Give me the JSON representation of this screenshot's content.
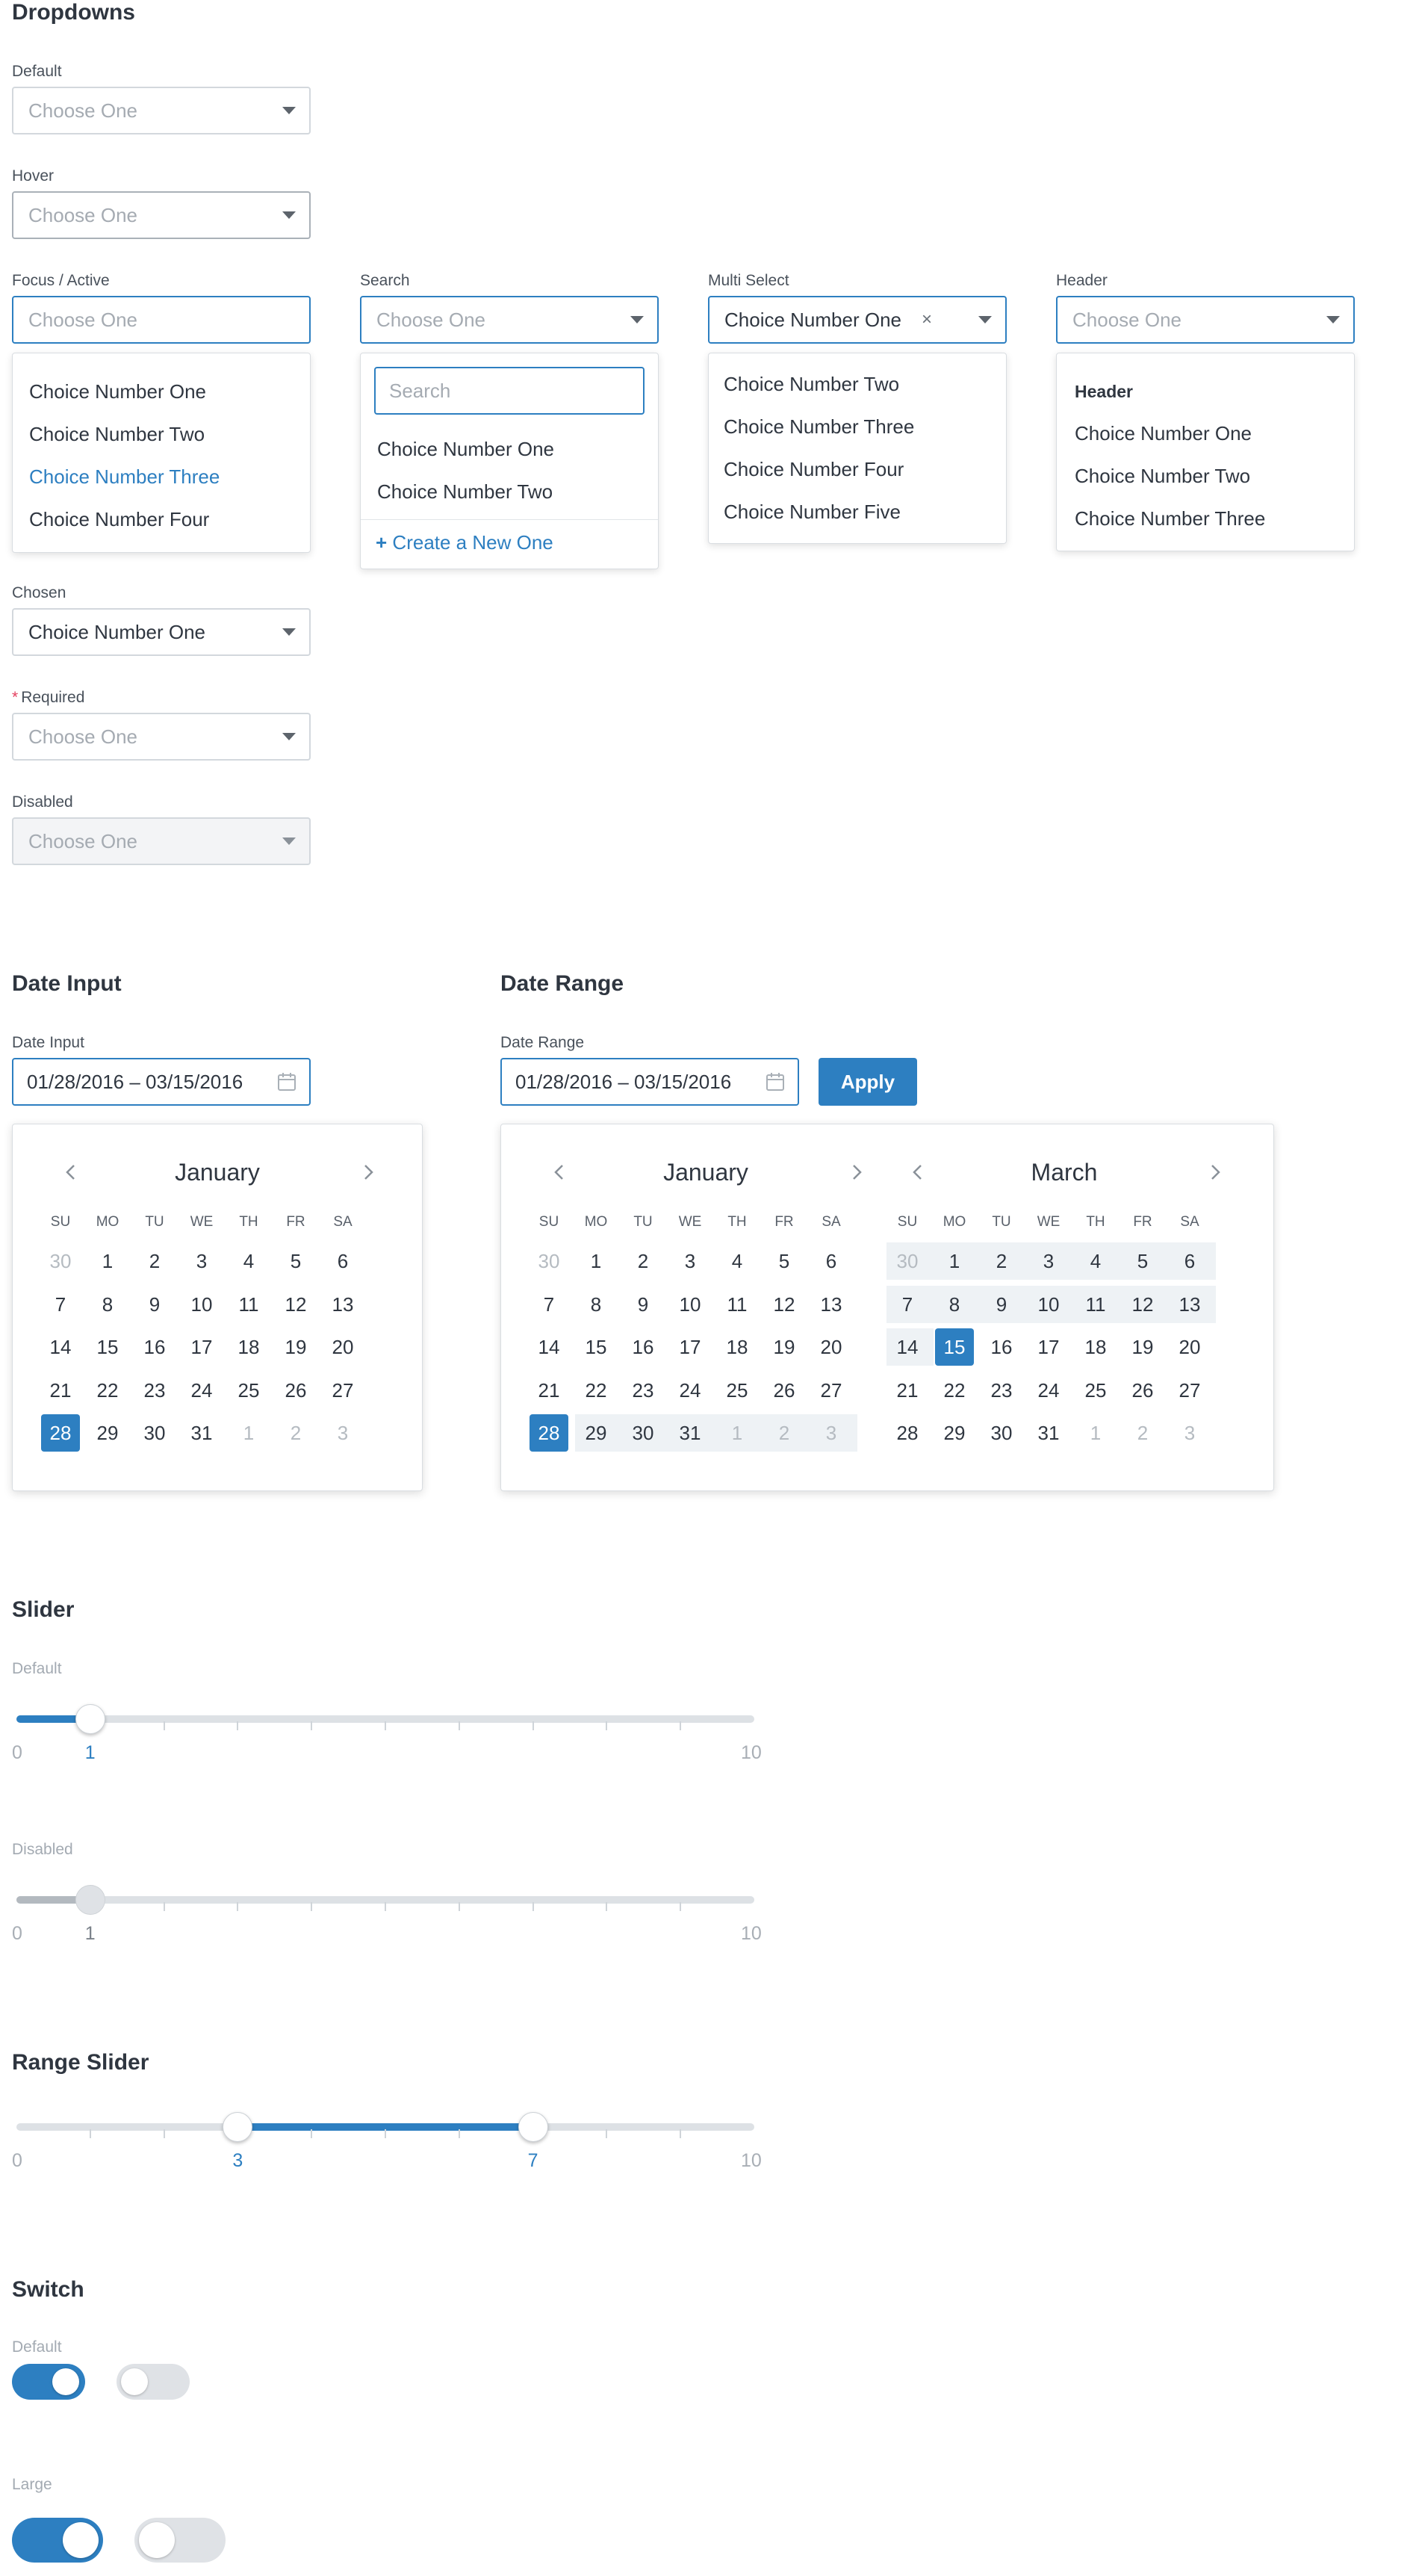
{
  "dropdowns": {
    "title": "Dropdowns",
    "default": {
      "label": "Default",
      "placeholder": "Choose One"
    },
    "hover": {
      "label": "Hover",
      "placeholder": "Choose One"
    },
    "focus": {
      "label": "Focus / Active",
      "placeholder": "Choose One",
      "options": [
        "Choice Number One",
        "Choice Number Two",
        "Choice Number Three",
        "Choice Number Four"
      ],
      "active_option": "Choice Number Three"
    },
    "search": {
      "label": "Search",
      "placeholder": "Choose One",
      "search_placeholder": "Search",
      "options": [
        "Choice Number One",
        "Choice Number Two"
      ],
      "create_label": "Create a New One",
      "create_icon": "plus-icon"
    },
    "multi": {
      "label": "Multi Select",
      "value": "Choice Number One",
      "clear_glyph": "×",
      "options": [
        "Choice Number Two",
        "Choice Number Three",
        "Choice Number Four",
        "Choice Number Five"
      ]
    },
    "header": {
      "label": "Header",
      "placeholder": "Choose One",
      "menu_header": "Header",
      "options": [
        "Choice Number One",
        "Choice Number Two",
        "Choice Number Three"
      ]
    },
    "chosen": {
      "label": "Chosen",
      "value": "Choice Number One"
    },
    "required": {
      "label": "Required",
      "marker": "*",
      "placeholder": "Choose One"
    },
    "disabled": {
      "label": "Disabled",
      "placeholder": "Choose One"
    }
  },
  "date_input": {
    "title": "Date Input",
    "label": "Date Input",
    "value": "01/28/2016 – 03/15/2016",
    "calendar": {
      "month": "January",
      "dow": [
        "SU",
        "MO",
        "TU",
        "WE",
        "TH",
        "FR",
        "SA"
      ],
      "weeks": [
        [
          "30",
          "1",
          "2",
          "3",
          "4",
          "5",
          "6"
        ],
        [
          "7",
          "8",
          "9",
          "10",
          "11",
          "12",
          "13"
        ],
        [
          "14",
          "15",
          "16",
          "17",
          "18",
          "19",
          "20"
        ],
        [
          "21",
          "22",
          "23",
          "24",
          "25",
          "26",
          "27"
        ],
        [
          "28",
          "29",
          "30",
          "31",
          "1",
          "2",
          "3"
        ]
      ],
      "selected": "28"
    }
  },
  "date_range": {
    "title": "Date Range",
    "label": "Date Range",
    "value": "01/28/2016 – 03/15/2016",
    "apply_label": "Apply",
    "calendars": [
      {
        "month": "January",
        "dow": [
          "SU",
          "MO",
          "TU",
          "WE",
          "TH",
          "FR",
          "SA"
        ],
        "weeks": [
          [
            "30",
            "1",
            "2",
            "3",
            "4",
            "5",
            "6"
          ],
          [
            "7",
            "8",
            "9",
            "10",
            "11",
            "12",
            "13"
          ],
          [
            "14",
            "15",
            "16",
            "17",
            "18",
            "19",
            "20"
          ],
          [
            "21",
            "22",
            "23",
            "24",
            "25",
            "26",
            "27"
          ],
          [
            "28",
            "29",
            "30",
            "31",
            "1",
            "2",
            "3"
          ]
        ],
        "selected": "28"
      },
      {
        "month": "March",
        "dow": [
          "SU",
          "MO",
          "TU",
          "WE",
          "TH",
          "FR",
          "SA"
        ],
        "weeks": [
          [
            "30",
            "1",
            "2",
            "3",
            "4",
            "5",
            "6"
          ],
          [
            "7",
            "8",
            "9",
            "10",
            "11",
            "12",
            "13"
          ],
          [
            "14",
            "15",
            "16",
            "17",
            "18",
            "19",
            "20"
          ],
          [
            "21",
            "22",
            "23",
            "24",
            "25",
            "26",
            "27"
          ],
          [
            "28",
            "29",
            "30",
            "31",
            "1",
            "2",
            "3"
          ]
        ],
        "selected": "15"
      }
    ]
  },
  "slider": {
    "title": "Slider",
    "default": {
      "label": "Default",
      "min": "0",
      "max": "10",
      "value": "1",
      "level": 1
    },
    "disabled": {
      "label": "Disabled",
      "min": "0",
      "max": "10",
      "value": "1",
      "level": 1
    }
  },
  "range_slider": {
    "title": "Range Slider",
    "min": "0",
    "max": "10",
    "low": "3",
    "high": "7",
    "low_level": 3,
    "high_level": 7
  },
  "switch": {
    "title": "Switch",
    "default_label": "Default",
    "large_label": "Large",
    "states": {
      "default_on": true,
      "default_off": false,
      "large_on": true,
      "large_off": false
    }
  },
  "colors": {
    "accent": "#2d7fc1",
    "required": "#e4405f",
    "text": "#2f3640",
    "muted": "#a5abb2"
  }
}
